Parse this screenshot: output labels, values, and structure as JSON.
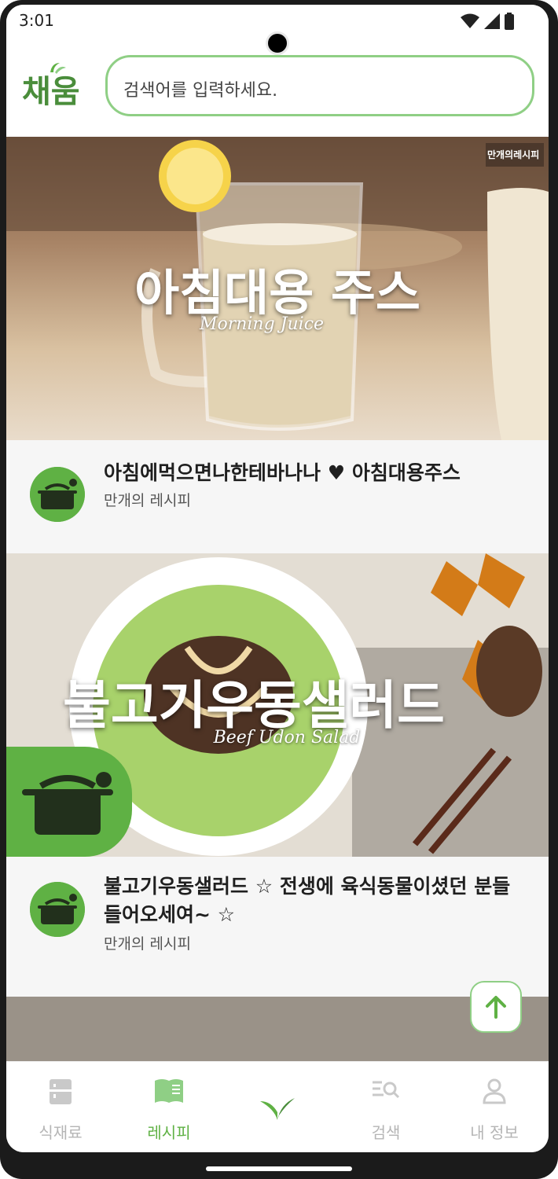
{
  "status": {
    "time": "3:01"
  },
  "header": {
    "logo_text": "채움",
    "search_placeholder": "검색어를 입력하세요."
  },
  "feed": [
    {
      "overlay_title": "아침대용 주스",
      "overlay_subtitle": "Morning Juice",
      "watermark": "만개의레시피",
      "title": "아침에먹으면나한테바나나 ♥ 아침대용주스",
      "channel": "만개의 레시피"
    },
    {
      "overlay_title": "불고기우동샐러드",
      "overlay_subtitle": "Beef Udon Salad",
      "title": "불고기우동샐러드 ☆ 전생에 육식동물이셨던 분들 들어오세여~ ☆",
      "channel": "만개의 레시피"
    }
  ],
  "nav": {
    "items": [
      {
        "label": "식재료",
        "icon": "fridge-icon",
        "active": false
      },
      {
        "label": "레시피",
        "icon": "book-icon",
        "active": true
      },
      {
        "label": "",
        "icon": "sprout-icon",
        "active": false
      },
      {
        "label": "검색",
        "icon": "list-search-icon",
        "active": false
      },
      {
        "label": "내 정보",
        "icon": "person-icon",
        "active": false
      }
    ]
  },
  "colors": {
    "accent": "#5fb144",
    "accent_light": "#8fcf85",
    "inactive": "#b5b5b5"
  }
}
